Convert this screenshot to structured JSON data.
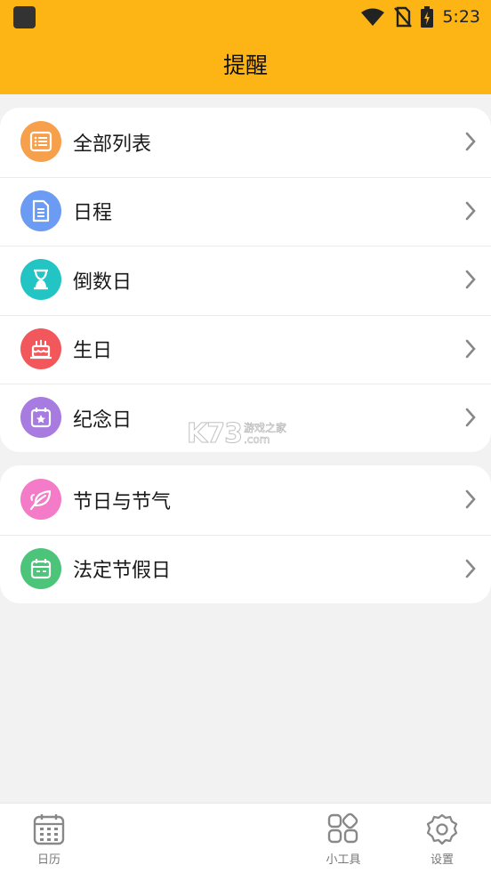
{
  "status_bar": {
    "time": "5:23"
  },
  "appbar": {
    "title": "提醒"
  },
  "group1": [
    {
      "label": "全部列表",
      "icon": "list-icon",
      "color": "#F7A04B"
    },
    {
      "label": "日程",
      "icon": "document-icon",
      "color": "#6B9BF2"
    },
    {
      "label": "倒数日",
      "icon": "hourglass-icon",
      "color": "#22C4C4"
    },
    {
      "label": "生日",
      "icon": "cake-icon",
      "color": "#F2585B"
    },
    {
      "label": "纪念日",
      "icon": "calendar-star-icon",
      "color": "#A77BE0"
    }
  ],
  "group2": [
    {
      "label": "节日与节气",
      "icon": "leaf-icon",
      "color": "#F47BC8"
    },
    {
      "label": "法定节假日",
      "icon": "calendar-icon",
      "color": "#4CC479"
    }
  ],
  "tabbar": {
    "calendar_label": "日历",
    "tools_label": "小工具",
    "settings_label": "设置"
  },
  "watermark": {
    "logo": "K73",
    "line1": "游戏之家",
    "line2": ".com"
  }
}
